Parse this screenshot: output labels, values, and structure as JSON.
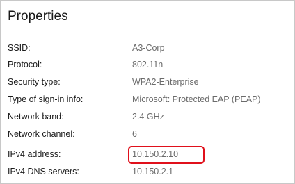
{
  "panel": {
    "title": "Properties"
  },
  "properties": [
    {
      "label": "SSID:",
      "value": "A3-Corp"
    },
    {
      "label": "Protocol:",
      "value": "802.11n"
    },
    {
      "label": "Security type:",
      "value": "WPA2-Enterprise"
    },
    {
      "label": "Type of sign-in info:",
      "value": "Microsoft: Protected EAP (PEAP)"
    },
    {
      "label": "Network band:",
      "value": "2.4 GHz"
    },
    {
      "label": "Network channel:",
      "value": "6"
    },
    {
      "label": "IPv4 address:",
      "value": "10.150.2.10",
      "highlighted": true
    },
    {
      "label": "IPv4 DNS servers:",
      "value": "10.150.2.1"
    }
  ],
  "colors": {
    "label_text": "#1a1a1a",
    "value_text": "#6b6b6b",
    "highlight_border": "#e0101b"
  }
}
